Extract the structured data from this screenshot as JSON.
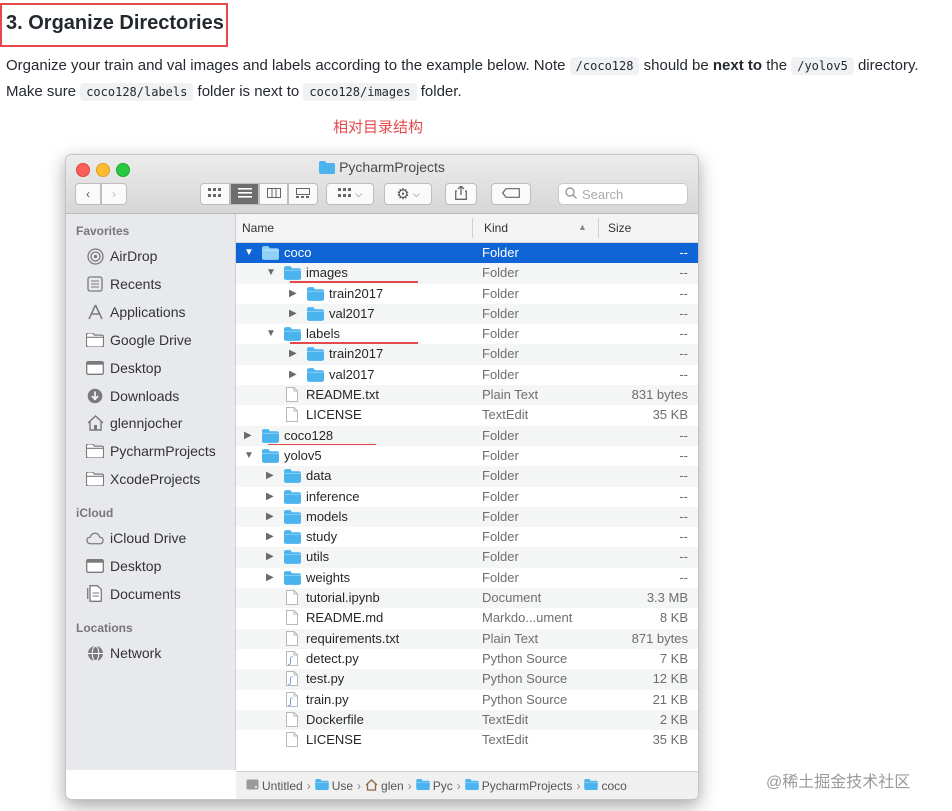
{
  "doc": {
    "heading": "3. Organize Directories",
    "para_1": "Organize your train and val images and labels according to the example below. Note ",
    "code_1": "/coco128",
    "para_2": " should be ",
    "bold_1": "next to",
    "para_3": " the ",
    "code_2": "/yolov5",
    "para_4": " directory. Make sure ",
    "code_3": "coco128/labels",
    "para_5": " folder is next to ",
    "code_4": "coco128/images",
    "para_6": " folder.",
    "caption": "相对目录结构"
  },
  "finder": {
    "title": "PycharmProjects",
    "search_placeholder": "Search",
    "columns": {
      "name": "Name",
      "kind": "Kind",
      "size": "Size"
    },
    "sidebar": [
      {
        "header": "Favorites",
        "items": [
          {
            "label": "AirDrop",
            "icon": "airdrop-icon"
          },
          {
            "label": "Recents",
            "icon": "recents-icon"
          },
          {
            "label": "Applications",
            "icon": "applications-icon"
          },
          {
            "label": "Google Drive",
            "icon": "folder-icon"
          },
          {
            "label": "Desktop",
            "icon": "desktop-icon"
          },
          {
            "label": "Downloads",
            "icon": "downloads-icon"
          },
          {
            "label": "glennjocher",
            "icon": "home-icon"
          },
          {
            "label": "PycharmProjects",
            "icon": "folder-icon"
          },
          {
            "label": "XcodeProjects",
            "icon": "folder-icon"
          }
        ]
      },
      {
        "header": "iCloud",
        "items": [
          {
            "label": "iCloud Drive",
            "icon": "cloud-icon"
          },
          {
            "label": "Desktop",
            "icon": "desktop-icon"
          },
          {
            "label": "Documents",
            "icon": "documents-icon"
          }
        ]
      },
      {
        "header": "Locations",
        "items": [
          {
            "label": "Network",
            "icon": "network-icon"
          }
        ]
      }
    ],
    "rows": [
      {
        "name": "coco",
        "kind": "Folder",
        "size": "--",
        "depth": 0,
        "type": "folder",
        "arrow": "down",
        "selected": true
      },
      {
        "name": "images",
        "kind": "Folder",
        "size": "--",
        "depth": 1,
        "type": "folder",
        "arrow": "down",
        "underline": true
      },
      {
        "name": "train2017",
        "kind": "Folder",
        "size": "--",
        "depth": 2,
        "type": "folder",
        "arrow": "right"
      },
      {
        "name": "val2017",
        "kind": "Folder",
        "size": "--",
        "depth": 2,
        "type": "folder",
        "arrow": "right"
      },
      {
        "name": "labels",
        "kind": "Folder",
        "size": "--",
        "depth": 1,
        "type": "folder",
        "arrow": "down",
        "underline": true
      },
      {
        "name": "train2017",
        "kind": "Folder",
        "size": "--",
        "depth": 2,
        "type": "folder",
        "arrow": "right"
      },
      {
        "name": "val2017",
        "kind": "Folder",
        "size": "--",
        "depth": 2,
        "type": "folder",
        "arrow": "right"
      },
      {
        "name": "README.txt",
        "kind": "Plain Text",
        "size": "831 bytes",
        "depth": 1,
        "type": "file"
      },
      {
        "name": "LICENSE",
        "kind": "TextEdit",
        "size": "35 KB",
        "depth": 1,
        "type": "file"
      },
      {
        "name": "coco128",
        "kind": "Folder",
        "size": "--",
        "depth": 0,
        "type": "folder",
        "arrow": "right",
        "underline": true
      },
      {
        "name": "yolov5",
        "kind": "Folder",
        "size": "--",
        "depth": 0,
        "type": "folder",
        "arrow": "down"
      },
      {
        "name": "data",
        "kind": "Folder",
        "size": "--",
        "depth": 1,
        "type": "folder",
        "arrow": "right"
      },
      {
        "name": "inference",
        "kind": "Folder",
        "size": "--",
        "depth": 1,
        "type": "folder",
        "arrow": "right"
      },
      {
        "name": "models",
        "kind": "Folder",
        "size": "--",
        "depth": 1,
        "type": "folder",
        "arrow": "right"
      },
      {
        "name": "study",
        "kind": "Folder",
        "size": "--",
        "depth": 1,
        "type": "folder",
        "arrow": "right"
      },
      {
        "name": "utils",
        "kind": "Folder",
        "size": "--",
        "depth": 1,
        "type": "folder",
        "arrow": "right"
      },
      {
        "name": "weights",
        "kind": "Folder",
        "size": "--",
        "depth": 1,
        "type": "folder",
        "arrow": "right"
      },
      {
        "name": "tutorial.ipynb",
        "kind": "Document",
        "size": "3.3 MB",
        "depth": 1,
        "type": "file"
      },
      {
        "name": "README.md",
        "kind": "Markdo...ument",
        "size": "8 KB",
        "depth": 1,
        "type": "file"
      },
      {
        "name": "requirements.txt",
        "kind": "Plain Text",
        "size": "871 bytes",
        "depth": 1,
        "type": "file"
      },
      {
        "name": "detect.py",
        "kind": "Python Source",
        "size": "7 KB",
        "depth": 1,
        "type": "py"
      },
      {
        "name": "test.py",
        "kind": "Python Source",
        "size": "12 KB",
        "depth": 1,
        "type": "py"
      },
      {
        "name": "train.py",
        "kind": "Python Source",
        "size": "21 KB",
        "depth": 1,
        "type": "py"
      },
      {
        "name": "Dockerfile",
        "kind": "TextEdit",
        "size": "2 KB",
        "depth": 1,
        "type": "file"
      },
      {
        "name": "LICENSE",
        "kind": "TextEdit",
        "size": "35 KB",
        "depth": 1,
        "type": "file"
      }
    ],
    "path": [
      {
        "label": "Untitled",
        "icon": "disk-icon"
      },
      {
        "label": "Use",
        "icon": "folder-icon"
      },
      {
        "label": "glen",
        "icon": "home-icon"
      },
      {
        "label": "Pyc",
        "icon": "folder-icon"
      },
      {
        "label": "PycharmProjects",
        "icon": "folder-icon"
      },
      {
        "label": "coco",
        "icon": "folder-icon"
      }
    ]
  },
  "watermark": "@稀土掘金技术社区",
  "colors": {
    "accent_red": "#e5484d",
    "selection_blue": "#0f64d6",
    "folder_blue": "#4bb4ee"
  }
}
